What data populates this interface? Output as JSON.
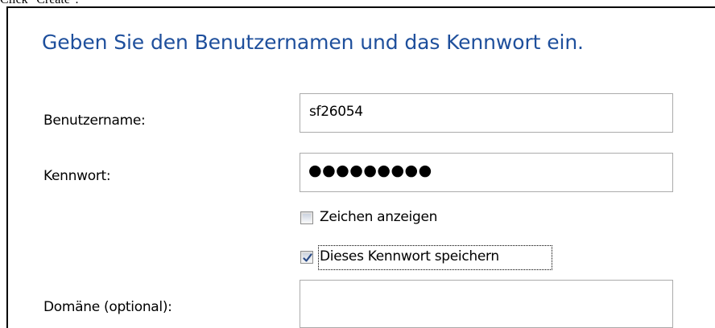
{
  "caption": "Click \"Create\".",
  "dialog": {
    "heading": "Geben Sie den Benutzernamen und das Kennwort ein.",
    "username": {
      "label": "Benutzername:",
      "value": "sf26054"
    },
    "password": {
      "label": "Kennwort:",
      "masked_value": "●●●●●●●●●"
    },
    "show_chars": {
      "label": "Zeichen anzeigen",
      "checked": false
    },
    "remember": {
      "label": "Dieses Kennwort speichern",
      "checked": true
    },
    "domain": {
      "label": "Domäne (optional):",
      "value": ""
    }
  },
  "colors": {
    "heading": "#1e4f9c",
    "check": "#2b4b86"
  }
}
